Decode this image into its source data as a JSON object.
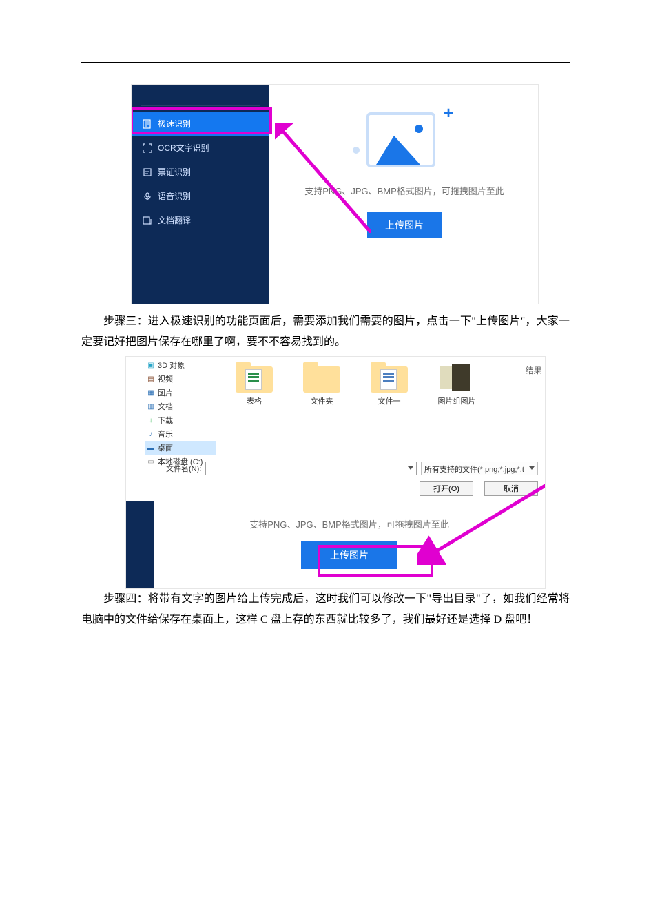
{
  "colors": {
    "accent": "#1a76e8",
    "sidebar": "#0d2a57",
    "highlight": "#e000d0"
  },
  "shot1": {
    "sidebar": {
      "items": [
        {
          "label": "极速识别",
          "icon": "doc-speed-icon",
          "active": true
        },
        {
          "label": "OCR文字识别",
          "icon": "ocr-icon"
        },
        {
          "label": "票证识别",
          "icon": "receipt-icon"
        },
        {
          "label": "语音识别",
          "icon": "mic-icon"
        },
        {
          "label": "文档翻译",
          "icon": "translate-icon"
        }
      ]
    },
    "support_line": "支持PNG、JPG、BMP格式图片，可拖拽图片至此",
    "upload_label": "上传图片"
  },
  "para3": "步骤三：进入极速识别的功能页面后，需要添加我们需要的图片，点击一下\"上传图片\"，大家一定要记好把图片保存在哪里了啊，要不不容易找到的。",
  "shot2": {
    "places": [
      {
        "label": "3D 对象",
        "color": "#28a5c8"
      },
      {
        "label": "视频",
        "color": "#8a5236"
      },
      {
        "label": "图片",
        "color": "#2b6fb5"
      },
      {
        "label": "文档",
        "color": "#2b6fb5"
      },
      {
        "label": "下载",
        "color": "#2bb54c"
      },
      {
        "label": "音乐",
        "color": "#2b6fb5"
      },
      {
        "label": "桌面",
        "color": "#2b6fb5",
        "selected": true
      },
      {
        "label": "本地磁盘 (C:)",
        "color": "#888"
      }
    ],
    "thumbs": [
      {
        "label": "表格",
        "kind": "excel"
      },
      {
        "label": "文件夹",
        "kind": "folder"
      },
      {
        "label": "文件一",
        "kind": "word"
      },
      {
        "label": "图片组图片",
        "kind": "pic"
      }
    ],
    "filename_label": "文件名(N):",
    "filename_value": "",
    "filter_value": "所有支持的文件(*.png;*.jpg;*.t",
    "open_label": "打开(O)",
    "cancel_label": "取消",
    "support_line": "支持PNG、JPG、BMP格式图片，可拖拽图片至此",
    "upload_label": "上传图片",
    "result_tab": "结果"
  },
  "para4": "步骤四：将带有文字的图片给上传完成后，这时我们可以修改一下\"导出目录\"了，如我们经常将电脑中的文件给保存在桌面上，这样 C 盘上存的东西就比较多了，我们最好还是选择 D 盘吧！"
}
